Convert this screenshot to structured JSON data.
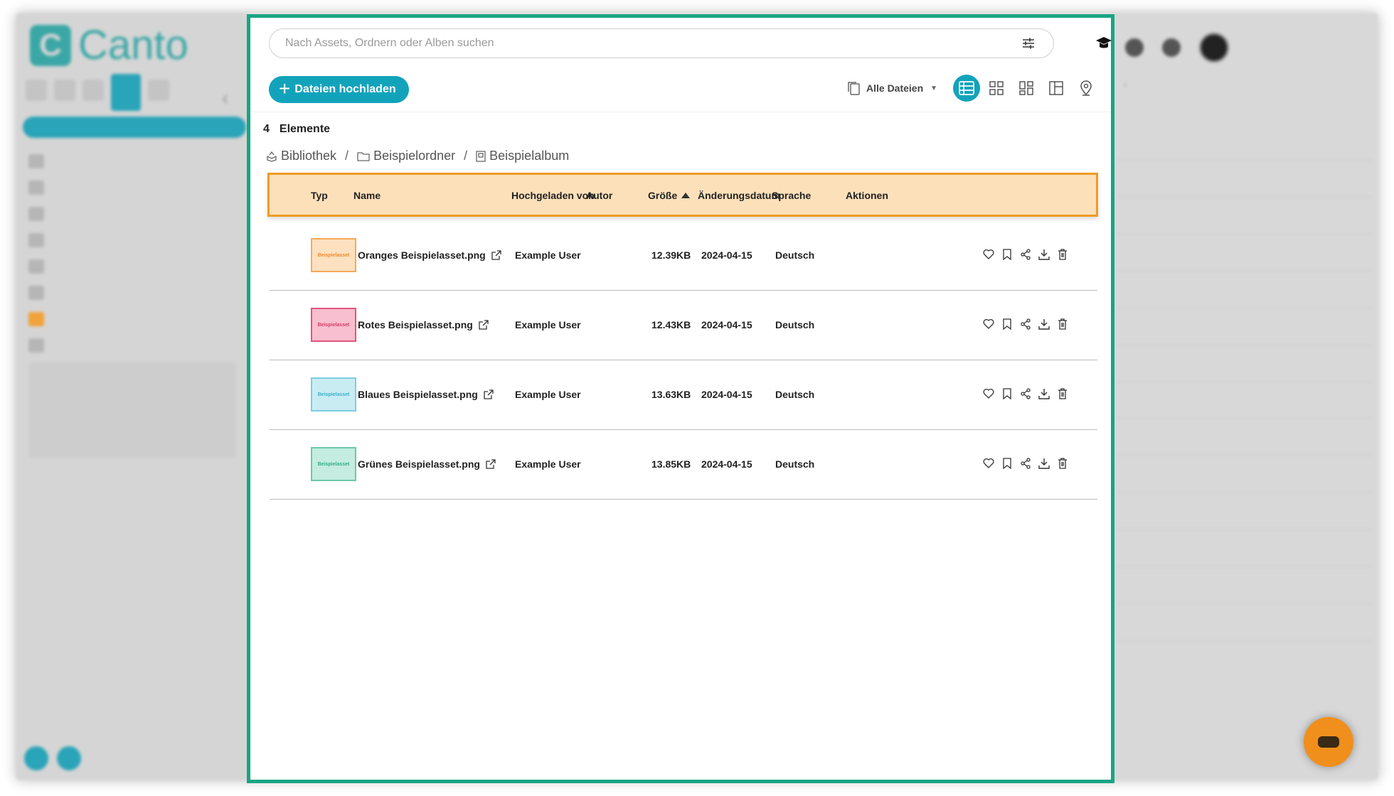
{
  "brand": {
    "name": "Canto",
    "mark": "C",
    "color": "#3aa7a6"
  },
  "search": {
    "placeholder": "Nach Assets, Ordnern oder Alben suchen",
    "filter_icon": "sliders-icon"
  },
  "toolbar": {
    "upload_label": "Dateien hochladen",
    "files_filter_label": "Alle Dateien",
    "views": [
      "list-view-icon",
      "grid-view-icon",
      "masonry-view-icon",
      "split-view-icon",
      "map-view-icon"
    ],
    "active_view": "list-view-icon"
  },
  "summary": {
    "count": "4",
    "count_label": "Elemente"
  },
  "breadcrumb": [
    {
      "label": "Bibliothek",
      "icon": "library-icon"
    },
    {
      "label": "Beispielordner",
      "icon": "folder-icon"
    },
    {
      "label": "Beispielalbum",
      "icon": "album-icon"
    }
  ],
  "table": {
    "columns": {
      "type": "Typ",
      "name": "Name",
      "uploaded_by": "Hochgeladen von",
      "author": "Autor",
      "size": "Größe",
      "modified": "Änderungsdatum",
      "language": "Sprache",
      "actions": "Aktionen"
    },
    "sort": {
      "column": "size",
      "direction": "asc"
    },
    "rows": [
      {
        "thumb_label": "Beispielasset",
        "thumb_bg": "#fde1c0",
        "thumb_border": "#f6a85a",
        "thumb_text": "#f08a2c",
        "name": "Oranges Beispielasset.png",
        "uploaded_by": "Example User",
        "author": "",
        "size": "12.39KB",
        "modified": "2024-04-15",
        "language": "Deutsch"
      },
      {
        "thumb_label": "Beispielasset",
        "thumb_bg": "#f7bfcf",
        "thumb_border": "#e2537b",
        "thumb_text": "#d63a66",
        "name": "Rotes Beispielasset.png",
        "uploaded_by": "Example User",
        "author": "",
        "size": "12.43KB",
        "modified": "2024-04-15",
        "language": "Deutsch"
      },
      {
        "thumb_label": "Beispielasset",
        "thumb_bg": "#c9ecf3",
        "thumb_border": "#7ccde0",
        "thumb_text": "#3ab1cc",
        "name": "Blaues Beispielasset.png",
        "uploaded_by": "Example User",
        "author": "",
        "size": "13.63KB",
        "modified": "2024-04-15",
        "language": "Deutsch"
      },
      {
        "thumb_label": "Beispielasset",
        "thumb_bg": "#c4ece0",
        "thumb_border": "#6cc9a8",
        "thumb_text": "#2fae86",
        "name": "Grünes Beispielasset.png",
        "uploaded_by": "Example User",
        "author": "",
        "size": "13.85KB",
        "modified": "2024-04-15",
        "language": "Deutsch"
      }
    ],
    "row_actions": [
      "favorite-icon",
      "bookmark-icon",
      "share-icon",
      "download-icon",
      "trash-icon"
    ]
  },
  "colors": {
    "accent": "#12a3bb",
    "highlight_frame": "#18a582",
    "header_highlight_bg": "#fbe0ba",
    "header_highlight_border": "#f09b24",
    "chat_button": "#f18f1c"
  }
}
